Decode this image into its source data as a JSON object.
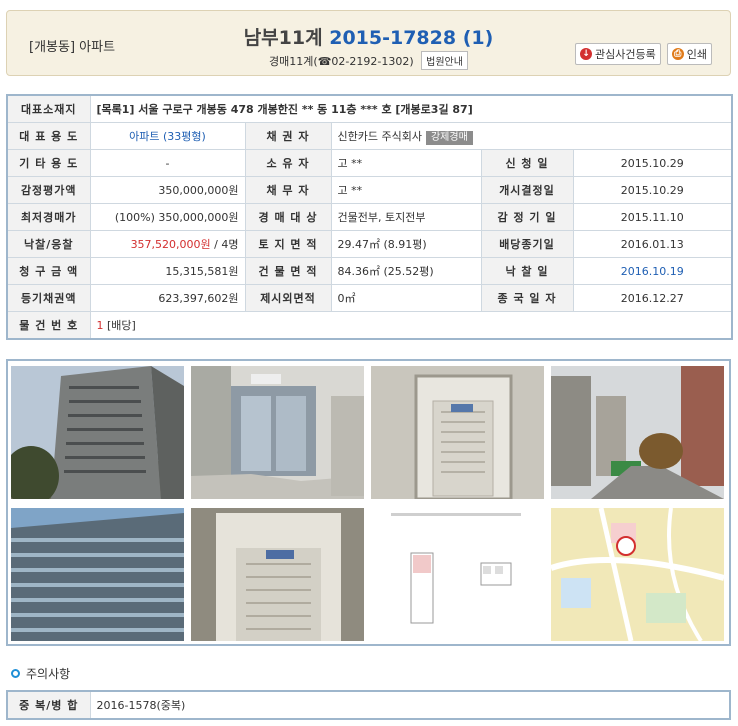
{
  "header": {
    "category": "[개봉동] 아파트",
    "court": "남부11계",
    "case_number": "2015-17828 (1)",
    "contact": "경매11계(☎02-2192-1302)",
    "court_guide_button": "법원안내",
    "bookmark_button": "관심사건등록",
    "print_button": "인쇄"
  },
  "info": {
    "address_label": "대표소재지",
    "address_value": "[목록1] 서울 구로구 개봉동 478 개봉한진 ** 동 11층 *** 호 [개봉로3길 87]",
    "usage_label": "대 표 용 도",
    "usage_value": "아파트 (33평형)",
    "creditor_label": "채   권   자",
    "creditor_value": "신한카드 주식회사",
    "creditor_badge": "강제경매",
    "other_usage_label": "기 타 용 도",
    "other_usage_value": "-",
    "owner_label": "소   유   자",
    "owner_value": "고 **",
    "apply_date_label": "신   청   일",
    "apply_date_value": "2015.10.29",
    "appraisal_label": "감정평가액",
    "appraisal_value": "350,000,000원",
    "debtor_label": "채   무   자",
    "debtor_value": "고 **",
    "start_decision_label": "개시결정일",
    "start_decision_value": "2015.10.29",
    "min_price_label": "최저경매가",
    "min_price_value": "(100%) 350,000,000원",
    "target_label": "경 매 대 상",
    "target_value": "건물전부, 토지전부",
    "appraisal_period_label": "감 정 기 일",
    "appraisal_period_value": "2015.11.10",
    "winning_label": "낙찰/응찰",
    "winning_price": "357,520,000원",
    "winning_bidders": " / 4명",
    "land_area_label": "토 지 면 적",
    "land_area_value": "29.47㎡ (8.91평)",
    "dividend_label": "배당종기일",
    "dividend_value": "2016.01.13",
    "claim_label": "청 구 금 액",
    "claim_value": "15,315,581원",
    "building_area_label": "건 물 면 적",
    "building_area_value": "84.36㎡ (25.52평)",
    "auction_date_label": "낙   찰   일",
    "auction_date_value": "2016.10.19",
    "registered_claim_label": "등기채권액",
    "registered_claim_value": "623,397,602원",
    "excluded_area_label": "제시외면적",
    "excluded_area_value": "0㎡",
    "end_date_label": "종 국 일 자",
    "end_date_value": "2016.12.27",
    "item_no_label": "물 건 번 호",
    "item_no_value": "1",
    "item_no_note": " [배당]"
  },
  "notice": {
    "heading": "주의사항",
    "dup_label": "중 복/병 합",
    "dup_value": "2016-1578(중복)"
  },
  "colors": {
    "accent_blue": "#1f5fb3",
    "red": "#d32f2f",
    "border": "#9eb6cc",
    "header_bg": "#f6f1e2"
  }
}
